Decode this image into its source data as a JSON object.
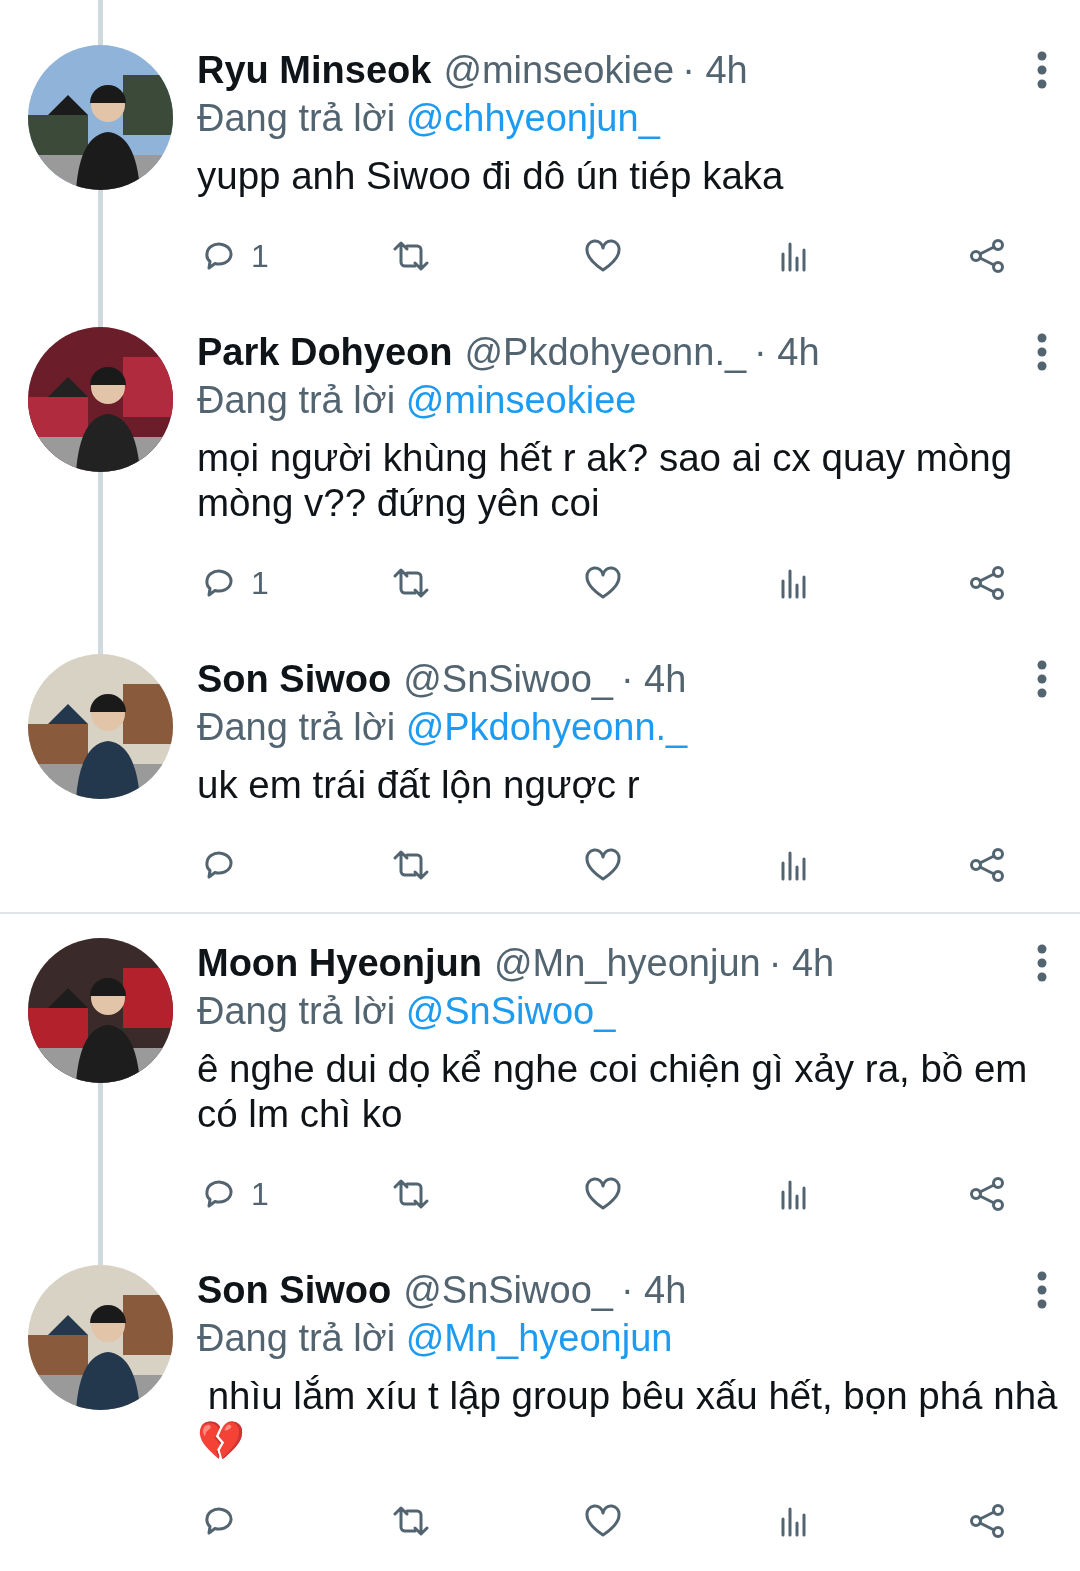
{
  "tweets": [
    {
      "name": "Ryu Minseok",
      "handle": "@minseokiee",
      "time": "· 4h",
      "reply_label": "Đang trả lời",
      "reply_to": "@chhyeonjun_",
      "text": "yupp anh Siwoo đi dô ún tiép kaka",
      "reply_count": "1",
      "connected_top": true,
      "connected_bottom": true,
      "divider_below": false
    },
    {
      "name": "Park Dohyeon",
      "handle": "@Pkdohyeonn._",
      "time": "· 4h",
      "reply_label": "Đang trả lời",
      "reply_to": "@minseokiee",
      "text": "mọi người khùng hết r ak? sao ai cx quay mòng mòng v?? đứng yên coi",
      "reply_count": "1",
      "connected_top": true,
      "connected_bottom": true,
      "divider_below": false
    },
    {
      "name": "Son Siwoo",
      "handle": "@SnSiwoo_",
      "time": "· 4h",
      "reply_label": "Đang trả lời",
      "reply_to": "@Pkdohyeonn._",
      "text": "uk em trái đất lộn ngược r",
      "connected_top": true,
      "connected_bottom": false,
      "divider_below": true
    },
    {
      "name": "Moon Hyeonjun",
      "handle": "@Mn_hyeonjun",
      "time": "· 4h",
      "reply_label": "Đang trả lời",
      "reply_to": "@SnSiwoo_",
      "text": "ê nghe dui dọ kể nghe coi chiện gì xảy ra, bồ em có lm chì ko",
      "reply_count": "1",
      "connected_top": false,
      "connected_bottom": true,
      "divider_below": false
    },
    {
      "name": "Son Siwoo",
      "handle": "@SnSiwoo_",
      "time": "· 4h",
      "reply_label": "Đang trả lời",
      "reply_to": "@Mn_hyeonjun",
      "text": " nhìu lắm xíu t lập group bêu xấu hết, bọn phá nhà💔",
      "connected_top": true,
      "connected_bottom": false,
      "divider_below": false
    }
  ]
}
